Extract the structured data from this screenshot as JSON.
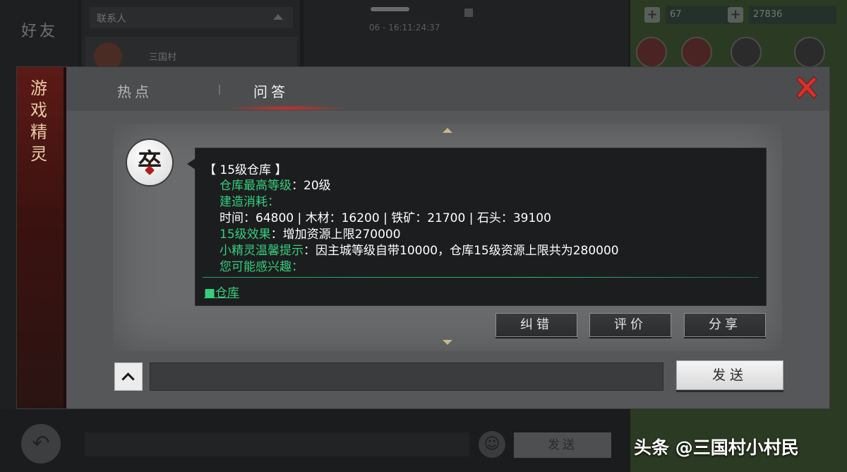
{
  "background": {
    "friends_label": "好友",
    "contacts_label": "联系人",
    "contact_name": "三国村",
    "chat_time": "06 - 16:11:24:37",
    "resource_1": "67",
    "resource_2": "27836",
    "send_label": "发送"
  },
  "dialog": {
    "sidebar_title": "游戏精灵",
    "tabs": [
      {
        "label": "热点",
        "active": false
      },
      {
        "label": "问答",
        "active": true
      }
    ],
    "avatar_char": "卒",
    "message": {
      "title": "【 15级仓库 】",
      "max_level_label": "仓库最高等级",
      "max_level_value": "：20级",
      "build_cost_label": "建造消耗：",
      "cost_line": "时间：64800 | 木材：16200 | 铁矿：21700 | 石头：39100",
      "effect_label": "15级效果",
      "effect_value": "：增加资源上限270000",
      "tip_label": "小精灵温馨提示",
      "tip_value": "：因主城等级自带10000，仓库15级资源上限共为280000",
      "interest_label": "您可能感兴趣：",
      "related_link": "■仓库"
    },
    "actions": {
      "fix": "纠错",
      "rate": "评价",
      "share": "分享"
    },
    "input": {
      "value": "",
      "placeholder": ""
    },
    "send_label": "发送"
  },
  "watermark": "头条 @三国村小村民",
  "colors": {
    "accent_green": "#35cf7e",
    "close_red": "#d8312b",
    "sidebar_red": "#5b1a16"
  },
  "icons": [
    "close-icon",
    "chevron-up-icon",
    "back-icon",
    "emoji-icon"
  ]
}
